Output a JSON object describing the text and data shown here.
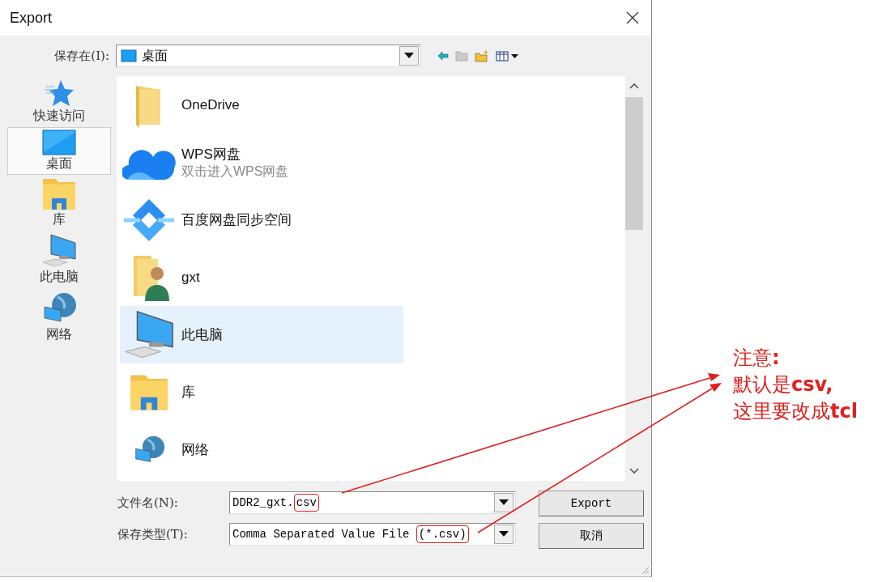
{
  "window": {
    "title": "Export"
  },
  "save_in": {
    "label": "保存在(I):",
    "value": "桌面"
  },
  "places": [
    {
      "label": "快速访问",
      "kind": "star",
      "selected": false
    },
    {
      "label": "桌面",
      "kind": "desktop",
      "selected": true
    },
    {
      "label": "库",
      "kind": "library",
      "selected": false
    },
    {
      "label": "此电脑",
      "kind": "computer",
      "selected": false
    },
    {
      "label": "网络",
      "kind": "network",
      "selected": false
    }
  ],
  "files": [
    {
      "name": "OneDrive",
      "kind": "folder",
      "selected": false
    },
    {
      "name": "WPS网盘",
      "subtitle": "双击进入WPS网盘",
      "kind": "cloud",
      "selected": false
    },
    {
      "name": "百度网盘同步空间",
      "kind": "sync",
      "selected": false
    },
    {
      "name": "gxt",
      "kind": "user-folder",
      "selected": false
    },
    {
      "name": "此电脑",
      "kind": "computer",
      "selected": true
    },
    {
      "name": "库",
      "kind": "library",
      "selected": false
    },
    {
      "name": "网络",
      "kind": "network",
      "selected": false
    }
  ],
  "filename": {
    "label": "文件名(N):",
    "text": "DDR2_gxt.",
    "highlight": "csv"
  },
  "filetype": {
    "label": "保存类型(T):",
    "text": "Comma Separated Value File ",
    "highlight": "(*.csv)"
  },
  "buttons": [
    "Export",
    "取消"
  ],
  "note": [
    "注意**:**",
    "默认是**csv,**",
    "这里要改成**tcl**"
  ]
}
